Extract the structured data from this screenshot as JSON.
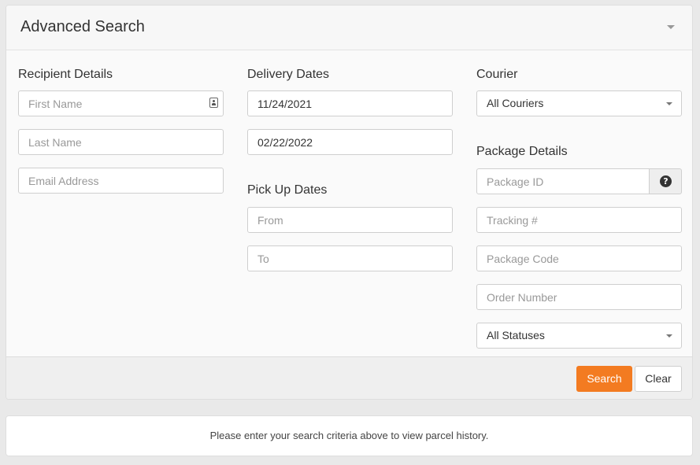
{
  "panel": {
    "title": "Advanced Search"
  },
  "recipient": {
    "heading": "Recipient Details",
    "first_name_placeholder": "First Name",
    "last_name_placeholder": "Last Name",
    "email_placeholder": "Email Address"
  },
  "delivery": {
    "heading": "Delivery Dates",
    "from_value": "11/24/2021",
    "to_value": "02/22/2022"
  },
  "pickup": {
    "heading": "Pick Up Dates",
    "from_placeholder": "From",
    "to_placeholder": "To"
  },
  "courier": {
    "heading": "Courier",
    "selected": "All Couriers"
  },
  "package": {
    "heading": "Package Details",
    "package_id_placeholder": "Package ID",
    "help_icon_glyph": "?",
    "tracking_placeholder": "Tracking #",
    "package_code_placeholder": "Package Code",
    "order_number_placeholder": "Order Number",
    "status_selected": "All Statuses"
  },
  "footer": {
    "search_label": "Search",
    "clear_label": "Clear"
  },
  "info": {
    "message": "Please enter your search criteria above to view parcel history."
  },
  "colors": {
    "accent": "#f37b21",
    "background": "#e9e9e9",
    "panel": "#fafafa"
  }
}
